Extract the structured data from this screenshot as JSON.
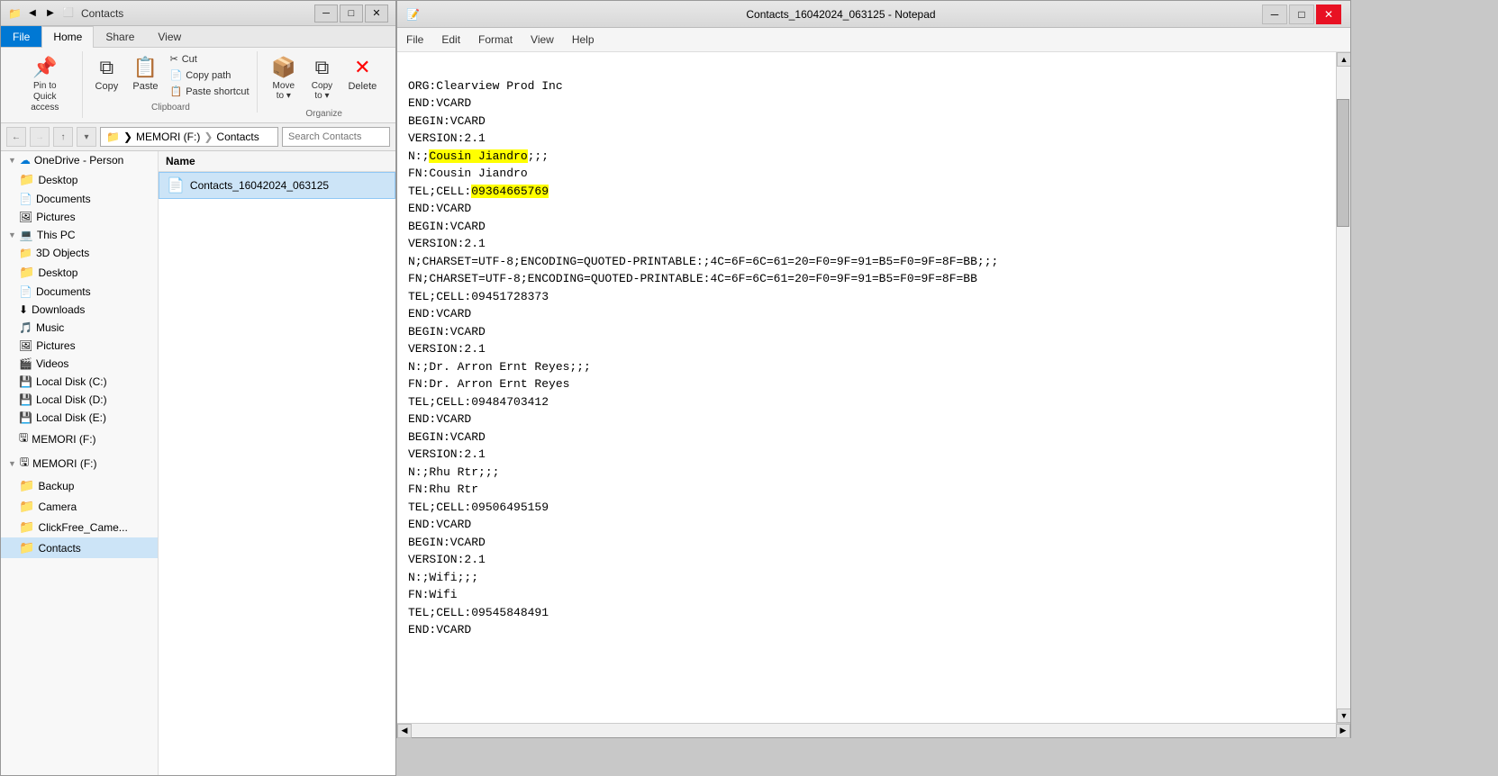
{
  "explorer": {
    "title": "Contacts",
    "title_icon": "📁",
    "ribbon": {
      "tabs": [
        "File",
        "Home",
        "Share",
        "View"
      ],
      "active_tab": "Home",
      "clipboard_group": "Clipboard",
      "organize_group": "Organize",
      "buttons": {
        "pin_label": "Pin to Quick\naccess",
        "copy_label": "Copy",
        "paste_label": "Paste",
        "cut_label": "Cut",
        "copy_path_label": "Copy path",
        "paste_shortcut_label": "Paste shortcut",
        "move_to_label": "Move\nto",
        "copy_to_label": "Copy\nto",
        "delete_label": "Delete"
      }
    },
    "address": {
      "path_parts": [
        "MEMORI (F:)",
        "Contacts"
      ],
      "search_placeholder": "Search Contacts"
    },
    "sidebar": {
      "items": [
        {
          "label": "OneDrive - Person",
          "icon": "cloud",
          "type": "cloud",
          "indent": 0
        },
        {
          "label": "Desktop",
          "icon": "folder",
          "type": "folder",
          "indent": 1
        },
        {
          "label": "Documents",
          "icon": "folder_doc",
          "type": "folder",
          "indent": 1
        },
        {
          "label": "Pictures",
          "icon": "folder_pic",
          "type": "folder",
          "indent": 1
        },
        {
          "label": "This PC",
          "icon": "pc",
          "type": "pc",
          "indent": 0
        },
        {
          "label": "3D Objects",
          "icon": "folder",
          "type": "folder",
          "indent": 1
        },
        {
          "label": "Desktop",
          "icon": "folder",
          "type": "folder",
          "indent": 1
        },
        {
          "label": "Documents",
          "icon": "folder_doc",
          "type": "folder",
          "indent": 1
        },
        {
          "label": "Downloads",
          "icon": "download",
          "type": "folder",
          "indent": 1
        },
        {
          "label": "Music",
          "icon": "music",
          "type": "folder",
          "indent": 1
        },
        {
          "label": "Pictures",
          "icon": "folder_pic",
          "type": "folder",
          "indent": 1
        },
        {
          "label": "Videos",
          "icon": "video",
          "type": "folder",
          "indent": 1
        },
        {
          "label": "Local Disk (C:)",
          "icon": "drive",
          "type": "drive",
          "indent": 1
        },
        {
          "label": "Local Disk (D:)",
          "icon": "drive",
          "type": "drive",
          "indent": 1
        },
        {
          "label": "Local Disk (E:)",
          "icon": "drive",
          "type": "drive",
          "indent": 1
        },
        {
          "label": "MEMORI (F:)",
          "icon": "drive_usb",
          "type": "drive",
          "indent": 1
        },
        {
          "label": "MEMORI (F:)",
          "icon": "drive_usb",
          "type": "drive_expand",
          "indent": 0
        },
        {
          "label": "Backup",
          "icon": "folder",
          "type": "folder",
          "indent": 2
        },
        {
          "label": "Camera",
          "icon": "folder",
          "type": "folder",
          "indent": 2
        },
        {
          "label": "ClickFree_Came...",
          "icon": "folder",
          "type": "folder",
          "indent": 2
        },
        {
          "label": "Contacts",
          "icon": "folder",
          "type": "folder_selected",
          "indent": 2
        }
      ]
    },
    "files": [
      {
        "name": "Contacts_16042024_063125",
        "icon": "📄",
        "selected": true
      }
    ]
  },
  "notepad": {
    "title": "Contacts_16042024_063125 - Notepad",
    "title_icon": "📝",
    "menu_items": [
      "File",
      "Edit",
      "Format",
      "View",
      "Help"
    ],
    "content_lines": [
      "ORG:Clearview Prod Inc",
      "END:VCARD",
      "BEGIN:VCARD",
      "VERSION:2.1",
      "N:;Cousin Jiandro;;;",
      "FN:Cousin Jiandro",
      "TEL;CELL:09364665769",
      "END:VCARD",
      "BEGIN:VCARD",
      "VERSION:2.1",
      "N;CHARSET=UTF-8;ENCODING=QUOTED-PRINTABLE:;4C=6F=6C=61=20=F0=9F=91=B5=F0=9F=8F=BB;;;",
      "FN;CHARSET=UTF-8;ENCODING=QUOTED-PRINTABLE:4C=6F=6C=61=20=F0=9F=91=B5=F0=9F=8F=BB",
      "TEL;CELL:09451728373",
      "END:VCARD",
      "BEGIN:VCARD",
      "VERSION:2.1",
      "N:;Dr. Arron Ernt Reyes;;;",
      "FN:Dr. Arron Ernt Reyes",
      "TEL;CELL:09484703412",
      "END:VCARD",
      "BEGIN:VCARD",
      "VERSION:2.1",
      "N:;Rhu Rtr;;;",
      "FN:Rhu Rtr",
      "TEL;CELL:09506495159",
      "END:VCARD",
      "BEGIN:VCARD",
      "VERSION:2.1",
      "N:;Wifi;;;",
      "FN:Wifi",
      "TEL;CELL:09545848491",
      "END:VCARD"
    ],
    "highlight_line": 4,
    "highlight_text_name": "Cousin Jiandro",
    "highlight_phone": "09364665769",
    "scrollbar": {
      "position": 5
    }
  },
  "colors": {
    "accent": "#0078d4",
    "highlight": "#ffff00",
    "folder": "#dcb956",
    "selected_bg": "#cce4f7"
  },
  "icons": {
    "back": "←",
    "forward": "→",
    "up": "↑",
    "recent": "⏷",
    "expand": "▶",
    "collapse": "▼",
    "minimize": "─",
    "maximize": "□",
    "close": "✕",
    "cloud": "☁",
    "pin": "📌",
    "cut": "✂",
    "copy": "⧉",
    "paste": "📋",
    "move": "→",
    "delete": "✕",
    "search": "🔍",
    "scroll_up": "▲",
    "scroll_down": "▼"
  }
}
